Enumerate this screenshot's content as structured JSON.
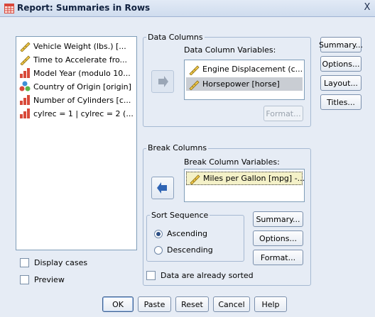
{
  "window": {
    "title": "Report: Summaries in Rows",
    "close_glyph": "X"
  },
  "variables": [
    {
      "label": "Vehicle Weight (lbs.) [...",
      "icon": "scale-ruler-icon"
    },
    {
      "label": "Time to Accelerate fro...",
      "icon": "scale-ruler-icon"
    },
    {
      "label": "Model Year (modulo 10...",
      "icon": "ordinal-bar-icon"
    },
    {
      "label": "Country of Origin [origin]",
      "icon": "nominal-balls-icon"
    },
    {
      "label": "Number of Cylinders [c...",
      "icon": "ordinal-bar-icon"
    },
    {
      "label": "cylrec = 1 | cylrec = 2 (...",
      "icon": "ordinal-bar-icon"
    }
  ],
  "display_cases": {
    "label": "Display cases",
    "checked": false
  },
  "preview": {
    "label": "Preview",
    "checked": false
  },
  "data_columns": {
    "group_title": "Data Columns",
    "list_label": "Data Column Variables:",
    "items": [
      {
        "label": "Engine Displacement (c...",
        "icon": "scale-ruler-icon"
      },
      {
        "label": "Horsepower [horse]",
        "icon": "scale-ruler-icon",
        "selected": true
      }
    ],
    "format_label": "Format..."
  },
  "break_columns": {
    "group_title": "Break Columns",
    "list_label": "Break Column Variables:",
    "items": [
      {
        "label": "Miles per Gallon [mpg] -...",
        "icon": "scale-ruler-icon",
        "focused": true
      }
    ]
  },
  "sort_sequence": {
    "group_title": "Sort Sequence",
    "options": [
      {
        "label": "Ascending",
        "selected": true
      },
      {
        "label": "Descending",
        "selected": false
      }
    ]
  },
  "break_buttons": {
    "summary": "Summary...",
    "options": "Options...",
    "format": "Format..."
  },
  "already_sorted": {
    "label": "Data are already sorted",
    "checked": false
  },
  "right_buttons": {
    "summary": "Summary...",
    "options": "Options...",
    "layout": "Layout...",
    "titles": "Titles..."
  },
  "bottom_buttons": {
    "ok": "OK",
    "paste": "Paste",
    "reset": "Reset",
    "cancel": "Cancel",
    "help": "Help"
  }
}
